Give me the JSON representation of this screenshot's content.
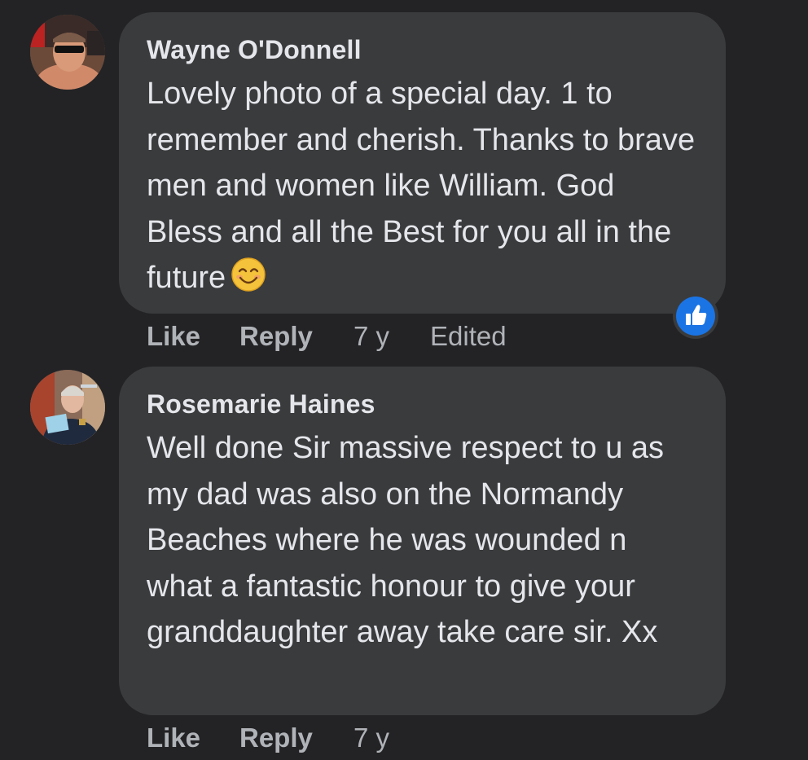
{
  "comments": [
    {
      "author": "Wayne O'Donnell",
      "text": "Lovely photo of a special day. 1 to remember and cherish. Thanks to brave men and women like William. God Bless and all the Best for you all in the future",
      "emoji": "smiling-face-icon",
      "like_label": "Like",
      "reply_label": "Reply",
      "time": "7 y",
      "edited_label": "Edited",
      "reaction": "like-reaction-icon"
    },
    {
      "author": "Rosemarie Haines",
      "text": "Well done Sir massive respect to u as my dad was also on the Normandy Beaches where he was wounded n what a fantastic honour to give your granddaughter away take care sir. Xx",
      "like_label": "Like",
      "reply_label": "Reply",
      "time": "7 y"
    }
  ],
  "colors": {
    "background": "#232325",
    "bubble": "#3a3b3c",
    "text": "#e4e6eb",
    "secondary_text": "#b0b3b8",
    "like_blue": "#1b74e4"
  }
}
